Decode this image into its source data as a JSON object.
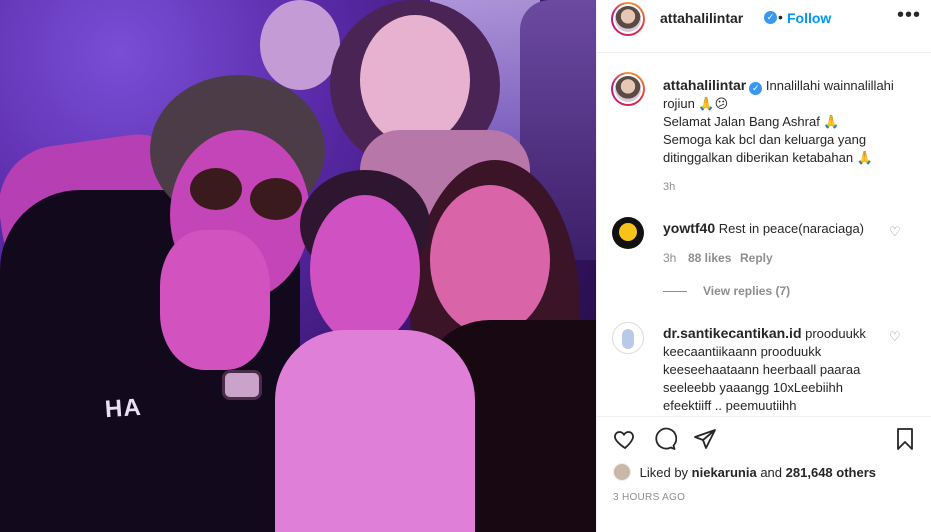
{
  "post": {
    "username": "attahalilintar",
    "follow_label": "Follow",
    "dot": "•",
    "more_label": "•••"
  },
  "caption": {
    "username": "attahalilintar",
    "line1": "Innalillahi wainnalillahi rojiun 🙏😕",
    "line2": "Selamat Jalan Bang Ashraf 🙏",
    "line3": "Semoga kak bcl dan keluarga yang ditinggalkan diberikan ketabahan 🙏",
    "time": "3h"
  },
  "comments": [
    {
      "username": "yowtf40",
      "text": "Rest in peace(naraciaga)",
      "time": "3h",
      "likes": "88 likes",
      "reply_label": "Reply",
      "view_replies": "View replies (7)"
    },
    {
      "username": "dr.santikecantikan.id",
      "text": "prooduukk keecaantiikaann prooduukk keeseehaataann heerbaall paaraa seeleebb yaaangg 10xLeebiihh efeektiiff .. peemuutiihh"
    }
  ],
  "footer": {
    "liked_by_prefix": "Liked by",
    "liked_by_user": "niekarunia",
    "and_label": "and",
    "others_count": "281,648 others",
    "posted_ago": "3 HOURS AGO"
  },
  "photo": {
    "shirt_text": "HA"
  },
  "colors": {
    "link_blue": "#0095f6",
    "verified_blue": "#3897f0",
    "muted_gray": "#8e8e8e"
  },
  "icons": [
    "verified-badge-icon",
    "more-options-icon",
    "heart-icon",
    "comment-icon",
    "share-icon",
    "bookmark-icon"
  ]
}
